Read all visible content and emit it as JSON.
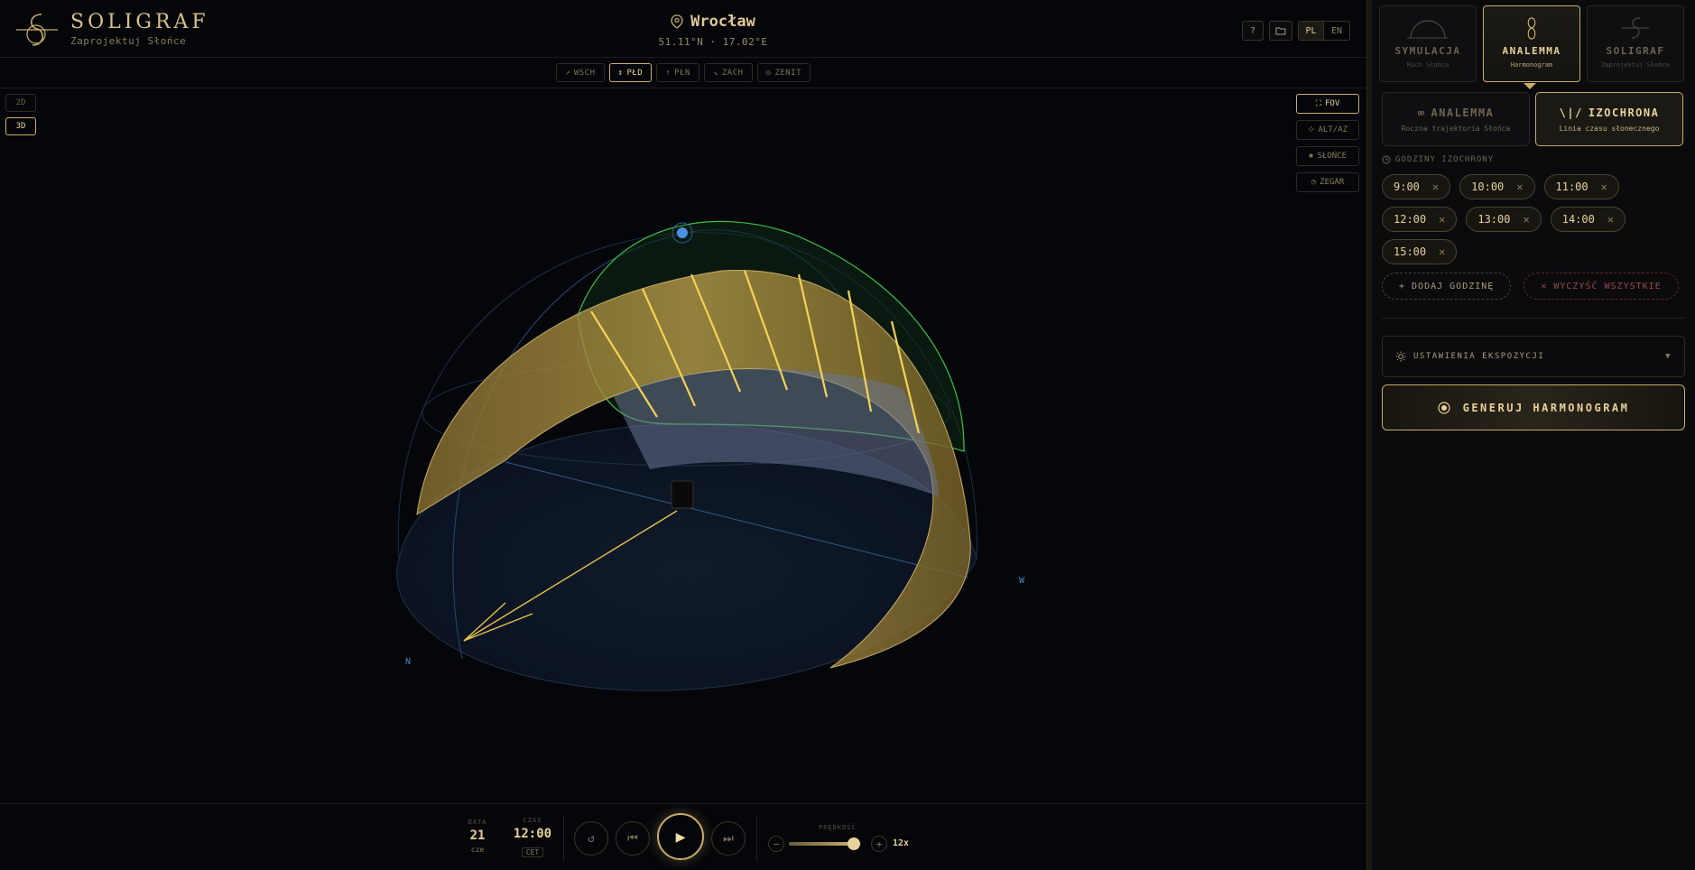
{
  "brand": {
    "title": "SOLIGRAF",
    "subtitle": "Zaprojektuj Słońce"
  },
  "location": {
    "name": "Wrocław",
    "coords": "51.11°N · 17.02°E"
  },
  "header_buttons": {
    "help": "?",
    "folder_icon": "folder-icon",
    "lang_active": "PL",
    "lang_other": "EN"
  },
  "directions": [
    {
      "icon": "↗",
      "label": "WSCH",
      "active": false
    },
    {
      "icon": "↕",
      "label": "PŁD",
      "active": true
    },
    {
      "icon": "↑",
      "label": "PŁN",
      "active": false
    },
    {
      "icon": "↘",
      "label": "ZACH",
      "active": false
    },
    {
      "icon": "◎",
      "label": "ZENIT",
      "active": false
    }
  ],
  "view_modes": [
    {
      "label": "2D",
      "active": false
    },
    {
      "label": "3D",
      "active": true
    }
  ],
  "tools": [
    {
      "icon": "⛶",
      "label": "FOV",
      "active": true
    },
    {
      "icon": "⊹",
      "label": "ALT/AZ",
      "active": false
    },
    {
      "icon": "✺",
      "label": "SŁOŃCE",
      "active": false
    },
    {
      "icon": "◷",
      "label": "ZEGAR",
      "active": false
    }
  ],
  "compass": {
    "n": "N",
    "w": "W"
  },
  "bottom": {
    "date_caption": "DATA",
    "date_value": "21",
    "date_sub": "cze",
    "time_caption": "CZAS",
    "time_value": "12:00",
    "time_zone": "CET",
    "speed_caption": "PRĘDKOŚĆ",
    "speed_value": "12x",
    "speed_level": 0.9,
    "reset_icon": "↺",
    "prev_icon": "⏮",
    "play_icon": "▶",
    "next_icon": "⏭",
    "minus": "−",
    "plus": "+"
  },
  "mode_tabs": [
    {
      "title": "SYMULACJA",
      "sub": "Ruch Słońca",
      "active": false
    },
    {
      "title": "ANALEMMA",
      "sub": "Harmonogram",
      "active": true
    },
    {
      "title": "SOLIGRAF",
      "sub": "Zaprojektuj Słońce",
      "active": false
    }
  ],
  "sub_tabs": [
    {
      "icon": "∞",
      "title": "ANALEMMA",
      "sub": "Roczna trajektoria Słońca",
      "active": false
    },
    {
      "icon": "\\|/",
      "title": "IZOCHRONA",
      "sub": "Linia czasu słonecznego",
      "active": true
    }
  ],
  "hours_label": "GODZINY IZOCHRONY",
  "hours": [
    "9:00",
    "10:00",
    "11:00",
    "12:00",
    "13:00",
    "14:00",
    "15:00"
  ],
  "chip_remove": "✕",
  "add_hour": "+ DODAJ GODZINĘ",
  "clear_all": "✕ WYCZYŚĆ WSZYSTKIE",
  "exposure_label": "USTAWIENIA EKSPOZYCJI",
  "exposure_chevron": "▼",
  "generate_label": "GENERUJ HARMONOGRAM",
  "colors": {
    "accent": "#c8ad6a",
    "green": "#3fbf4a",
    "blue": "#3a6ea8",
    "bg": "#05060a"
  }
}
